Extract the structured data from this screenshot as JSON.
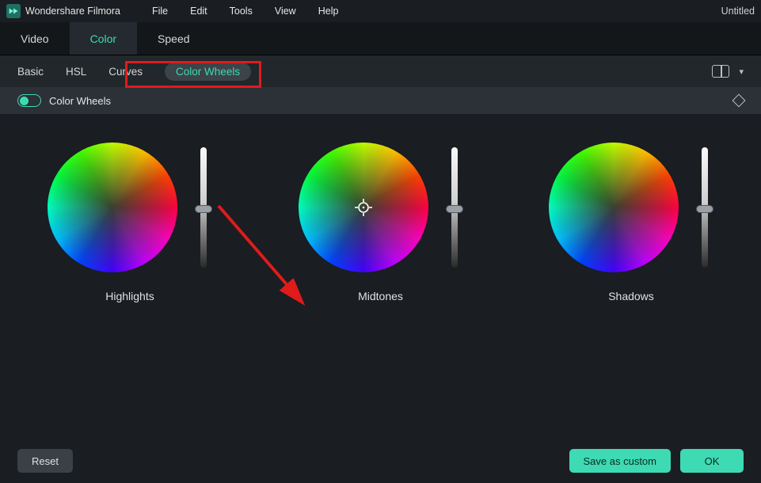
{
  "app_name": "Wondershare Filmora",
  "menus": {
    "file": "File",
    "edit": "Edit",
    "tools": "Tools",
    "view": "View",
    "help": "Help"
  },
  "doc_title": "Untitled",
  "primary_tabs": {
    "video": "Video",
    "color": "Color",
    "speed": "Speed",
    "active": "color"
  },
  "sub_tabs": {
    "basic": "Basic",
    "hsl": "HSL",
    "curves": "Curves",
    "color_wheels": "Color Wheels",
    "active": "color_wheels"
  },
  "section": {
    "label": "Color Wheels",
    "enabled": true
  },
  "wheels": {
    "highlights": {
      "label": "Highlights",
      "slider_pos": 0.48
    },
    "midtones": {
      "label": "Midtones",
      "slider_pos": 0.48
    },
    "shadows": {
      "label": "Shadows",
      "slider_pos": 0.48
    }
  },
  "footer": {
    "reset": "Reset",
    "save_custom": "Save as custom",
    "ok": "OK"
  },
  "accent": "#3ddab4",
  "annotations": {
    "red_highlight_tabs": [
      "Curves",
      "Color Wheels"
    ],
    "arrow_target": "midtones-wheel"
  }
}
